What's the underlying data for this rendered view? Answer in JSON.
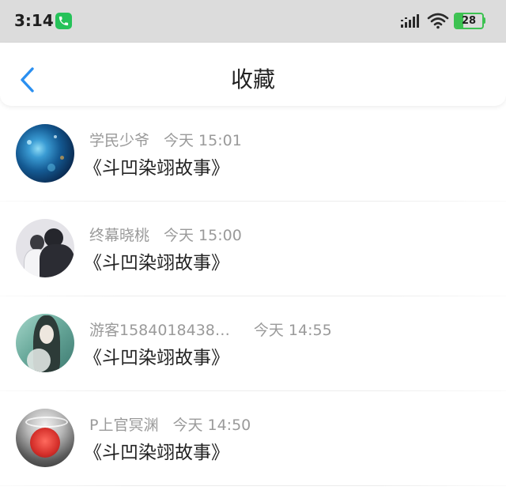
{
  "status_bar": {
    "time": "3:14",
    "battery": "28",
    "icons": [
      "phone-icon",
      "signal-icon",
      "wifi-icon",
      "battery-icon"
    ]
  },
  "header": {
    "title": "收藏",
    "back_icon": "chevron-left-icon"
  },
  "colors": {
    "accent": "#2a8ff0",
    "call_green": "#25c259",
    "battery_green": "#3cc251",
    "name_gray": "#9a9a9a",
    "text_dark": "#222222"
  },
  "favorites": [
    {
      "name": "学民少爷",
      "time": "今天 15:01",
      "message": "《斗凹染翊故事》"
    },
    {
      "name": "终幕晓桃",
      "time": "今天 15:00",
      "message": "《斗凹染翊故事》"
    },
    {
      "name": "游客1584018438…",
      "time": "今天 14:55",
      "message": "《斗凹染翊故事》"
    },
    {
      "name": "P上官冥渊",
      "time": "今天 14:50",
      "message": "《斗凹染翊故事》"
    }
  ]
}
